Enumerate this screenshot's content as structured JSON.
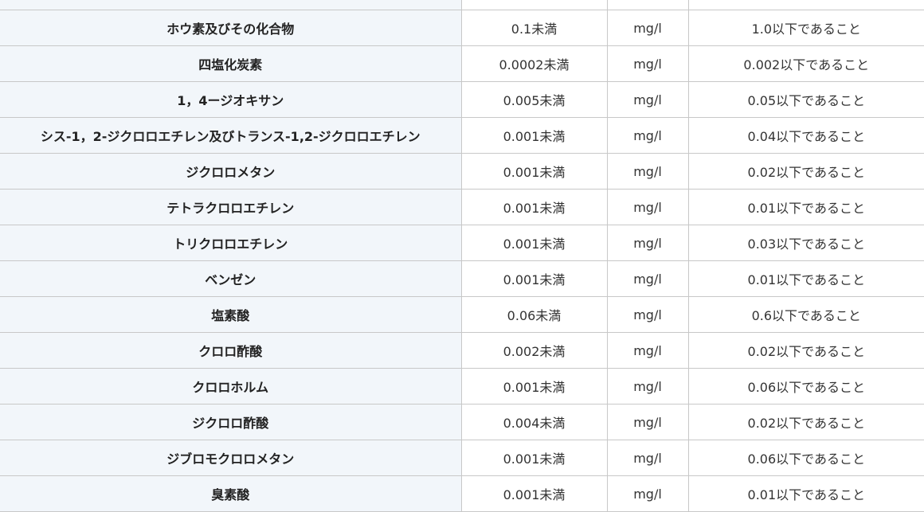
{
  "table": {
    "rows": [
      {
        "name": "",
        "value": "",
        "unit": "",
        "standard": ""
      },
      {
        "name": "ホウ素及びその化合物",
        "value": "0.1未満",
        "unit": "mg/l",
        "standard": "1.0以下であること"
      },
      {
        "name": "四塩化炭素",
        "value": "0.0002未満",
        "unit": "mg/l",
        "standard": "0.002以下であること"
      },
      {
        "name": "1，4ージオキサン",
        "value": "0.005未満",
        "unit": "mg/l",
        "standard": "0.05以下であること"
      },
      {
        "name": "シス-1，2-ジクロロエチレン及びトランス-1,2-ジクロロエチレン",
        "value": "0.001未満",
        "unit": "mg/l",
        "standard": "0.04以下であること"
      },
      {
        "name": "ジクロロメタン",
        "value": "0.001未満",
        "unit": "mg/l",
        "standard": "0.02以下であること"
      },
      {
        "name": "テトラクロロエチレン",
        "value": "0.001未満",
        "unit": "mg/l",
        "standard": "0.01以下であること"
      },
      {
        "name": "トリクロロエチレン",
        "value": "0.001未満",
        "unit": "mg/l",
        "standard": "0.03以下であること"
      },
      {
        "name": "ベンゼン",
        "value": "0.001未満",
        "unit": "mg/l",
        "standard": "0.01以下であること"
      },
      {
        "name": "塩素酸",
        "value": "0.06未満",
        "unit": "mg/l",
        "standard": "0.6以下であること"
      },
      {
        "name": "クロロ酢酸",
        "value": "0.002未満",
        "unit": "mg/l",
        "standard": "0.02以下であること"
      },
      {
        "name": "クロロホルム",
        "value": "0.001未満",
        "unit": "mg/l",
        "standard": "0.06以下であること"
      },
      {
        "name": "ジクロロ酢酸",
        "value": "0.004未満",
        "unit": "mg/l",
        "standard": "0.02以下であること"
      },
      {
        "name": "ジブロモクロロメタン",
        "value": "0.001未満",
        "unit": "mg/l",
        "standard": "0.06以下であること"
      },
      {
        "name": "臭素酸",
        "value": "0.001未満",
        "unit": "mg/l",
        "standard": "0.01以下であること"
      }
    ]
  }
}
